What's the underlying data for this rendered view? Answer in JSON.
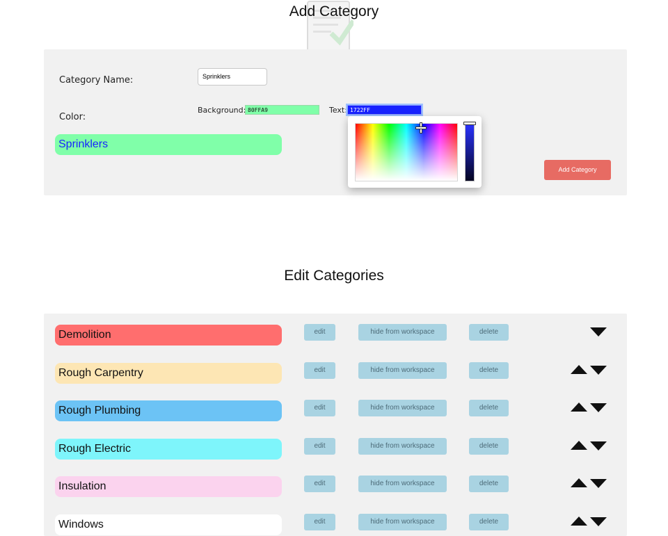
{
  "add_section": {
    "title": "Add Category",
    "name_label": "Category Name:",
    "name_value": "Sprinklers",
    "color_label": "Color:",
    "bg_label": "Background:",
    "bg_value": "80FFA9",
    "text_label": "Text:",
    "text_value": "1722FF",
    "preview_text": "Sprinklers",
    "preview_bg": "#80FFA9",
    "preview_fg": "#1722FF",
    "add_button": "Add Category",
    "add_button_color": "#e76b63"
  },
  "edit_section": {
    "title": "Edit Categories",
    "edit_label": "edit",
    "hide_label": "hide from workspace",
    "delete_label": "delete",
    "rows": [
      {
        "name": "Demolition",
        "bg": "#ff6e6e",
        "fg": "#111111",
        "up": false,
        "down": true
      },
      {
        "name": "Rough Carpentry",
        "bg": "#fde6b4",
        "fg": "#111111",
        "up": true,
        "down": true
      },
      {
        "name": "Rough Plumbing",
        "bg": "#6cc3f5",
        "fg": "#111111",
        "up": true,
        "down": true
      },
      {
        "name": "Rough Electric",
        "bg": "#7ef5fb",
        "fg": "#111111",
        "up": true,
        "down": true
      },
      {
        "name": "Insulation",
        "bg": "#fbd3ee",
        "fg": "#111111",
        "up": true,
        "down": true
      },
      {
        "name": "Windows",
        "bg": "#ffffff",
        "fg": "#111111",
        "up": true,
        "down": true
      }
    ]
  }
}
